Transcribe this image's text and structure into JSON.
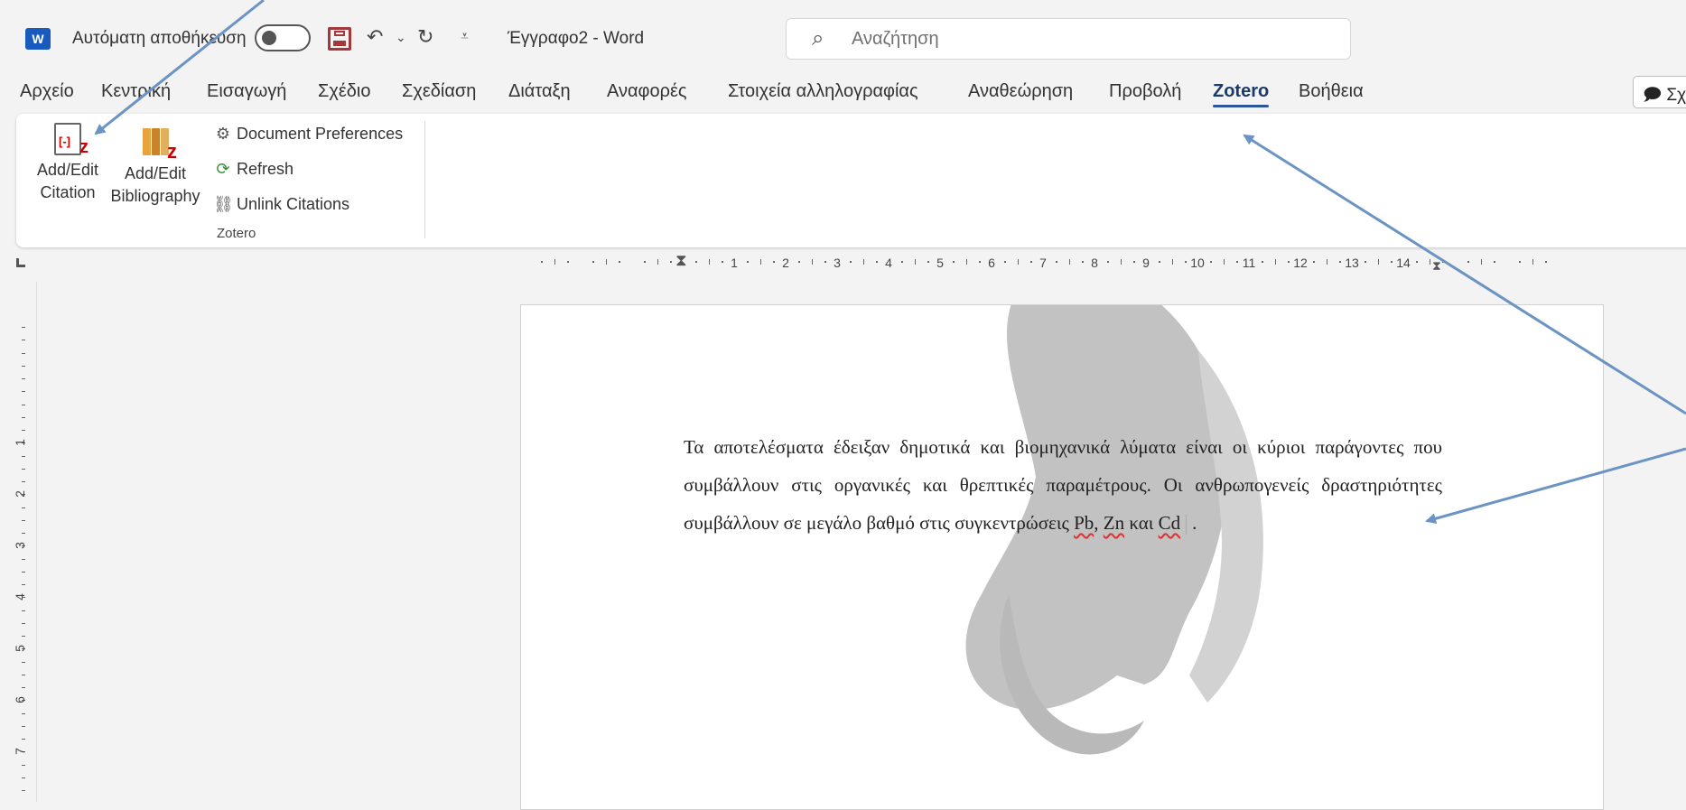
{
  "titlebar": {
    "autosave_label": "Αυτόματη αποθήκευση",
    "doc_title": "Έγγραφο2  -  Word",
    "search_placeholder": "Αναζήτηση",
    "comments_label": "Σχ"
  },
  "tabs": [
    {
      "label": "Αρχείο"
    },
    {
      "label": "Κεντρική"
    },
    {
      "label": "Εισαγωγή"
    },
    {
      "label": "Σχέδιο"
    },
    {
      "label": "Σχεδίαση"
    },
    {
      "label": "Διάταξη"
    },
    {
      "label": "Αναφορές"
    },
    {
      "label": "Στοιχεία αλληλογραφίας"
    },
    {
      "label": "Αναθεώρηση"
    },
    {
      "label": "Προβολή"
    },
    {
      "label": "Zotero"
    },
    {
      "label": "Βοήθεια"
    }
  ],
  "active_tab": "Zotero",
  "ribbon": {
    "add_edit_citation": {
      "line1": "Add/Edit",
      "line2": "Citation"
    },
    "add_edit_bibliography": {
      "line1": "Add/Edit",
      "line2": "Bibliography"
    },
    "document_preferences": "Document Preferences",
    "refresh": "Refresh",
    "unlink_citations": "Unlink Citations",
    "group_label": "Zotero"
  },
  "ruler": {
    "h_numbers": [
      "1",
      "2",
      "3",
      "4",
      "5",
      "6",
      "7",
      "8",
      "9",
      "10",
      "11",
      "12",
      "13",
      "14"
    ],
    "v_numbers": [
      "1",
      "2",
      "3",
      "4",
      "5",
      "6",
      "7"
    ]
  },
  "document": {
    "text_main": "Τα αποτελέσματα έδειξαν δημοτικά και βιομηχανικά λύματα είναι οι κύριοι παράγοντες που συμβάλλουν στις οργανικές και θρεπτικές παραμέτρους. Οι ανθρωπογενείς δραστηριότητες συμβάλλουν σε μεγάλο βαθμό στις συγκεντρώσεις ",
    "pb": "Pb",
    "sep1": ", ",
    "zn": "Zn",
    "and": " και ",
    "cd": "Cd",
    "end": "."
  },
  "colors": {
    "accent": "#2b579a",
    "arrow": "#6b93c4",
    "zotero_red": "#cc2222"
  }
}
